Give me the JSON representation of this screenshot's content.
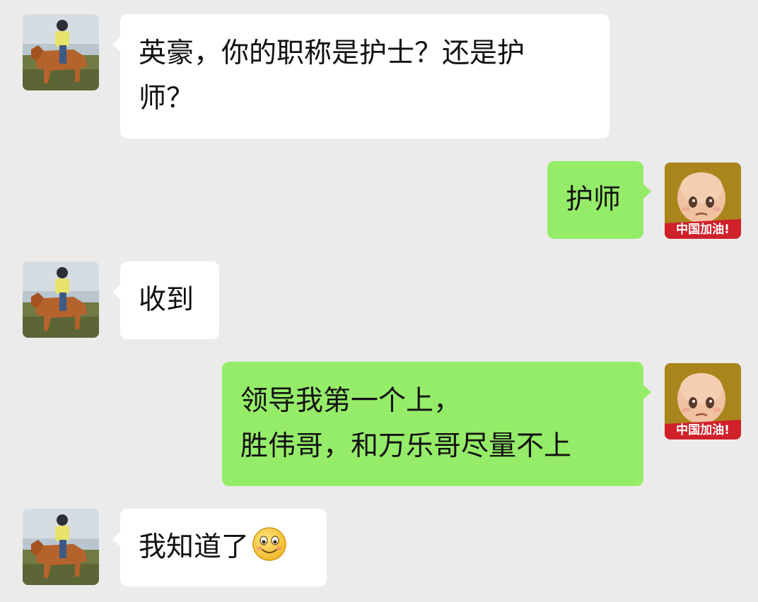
{
  "messages": [
    {
      "direction": "incoming",
      "avatar": "horse-rider-avatar",
      "lines": [
        "英豪，你的职称是护士？还是护",
        "师？"
      ]
    },
    {
      "direction": "outgoing",
      "avatar": "cartoon-boy-avatar",
      "avatar_badge": "中国加油!",
      "lines": [
        "护师"
      ]
    },
    {
      "direction": "incoming",
      "avatar": "horse-rider-avatar",
      "lines": [
        "收到"
      ]
    },
    {
      "direction": "outgoing",
      "avatar": "cartoon-boy-avatar",
      "avatar_badge": "中国加油!",
      "lines": [
        "领导我第一个上，",
        "胜伟哥，和万乐哥尽量不上"
      ]
    },
    {
      "direction": "incoming",
      "avatar": "horse-rider-avatar",
      "lines": [
        "我知道了"
      ],
      "emoji": "smile-emoji"
    }
  ],
  "colors": {
    "background": "#ebebeb",
    "incoming_bubble": "#ffffff",
    "outgoing_bubble": "#95ec69",
    "badge_red": "#d0202a"
  }
}
